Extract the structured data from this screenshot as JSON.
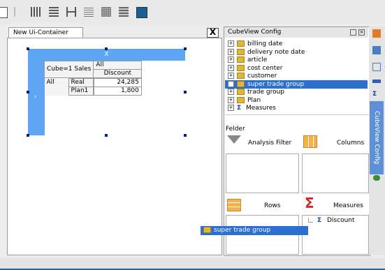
{
  "left_tab": {
    "label": "New Ui-Container"
  },
  "close_label": "X",
  "pivot": {
    "expand_label": "X",
    "cube_label": "Cube=1 Sales",
    "all_header": "All",
    "measure_header": "Discount",
    "row_all": "All",
    "rows": [
      {
        "label": "Real",
        "value": "24,285"
      },
      {
        "label": "Plan1",
        "value": "1,800"
      }
    ]
  },
  "config": {
    "title": "CubeView Config",
    "tree": [
      {
        "label": "billing date",
        "icon": "folder-icon"
      },
      {
        "label": "delivery note date",
        "icon": "folder-icon"
      },
      {
        "label": "article",
        "icon": "folder-icon"
      },
      {
        "label": "cost center",
        "icon": "folder-icon"
      },
      {
        "label": "customer",
        "icon": "folder-icon"
      },
      {
        "label": "super trade group",
        "icon": "folder-icon",
        "selected": true
      },
      {
        "label": "trade group",
        "icon": "folder-icon"
      },
      {
        "label": "Plan",
        "icon": "folder-icon"
      },
      {
        "label": "Measures",
        "icon": "sigma-icon"
      }
    ],
    "felder_label": "Felder",
    "analysis_filter_label": "Analysis Filter",
    "columns_label": "Columns",
    "rows_label": "Rows",
    "measures_label": "Measures",
    "measures_items": [
      "Discount"
    ]
  },
  "side_tab": {
    "label": "CubeView Config"
  },
  "drag_item": {
    "label": "super trade group"
  },
  "colors": {
    "accent": "#5ea6f4",
    "selection": "#2b6fd3"
  }
}
